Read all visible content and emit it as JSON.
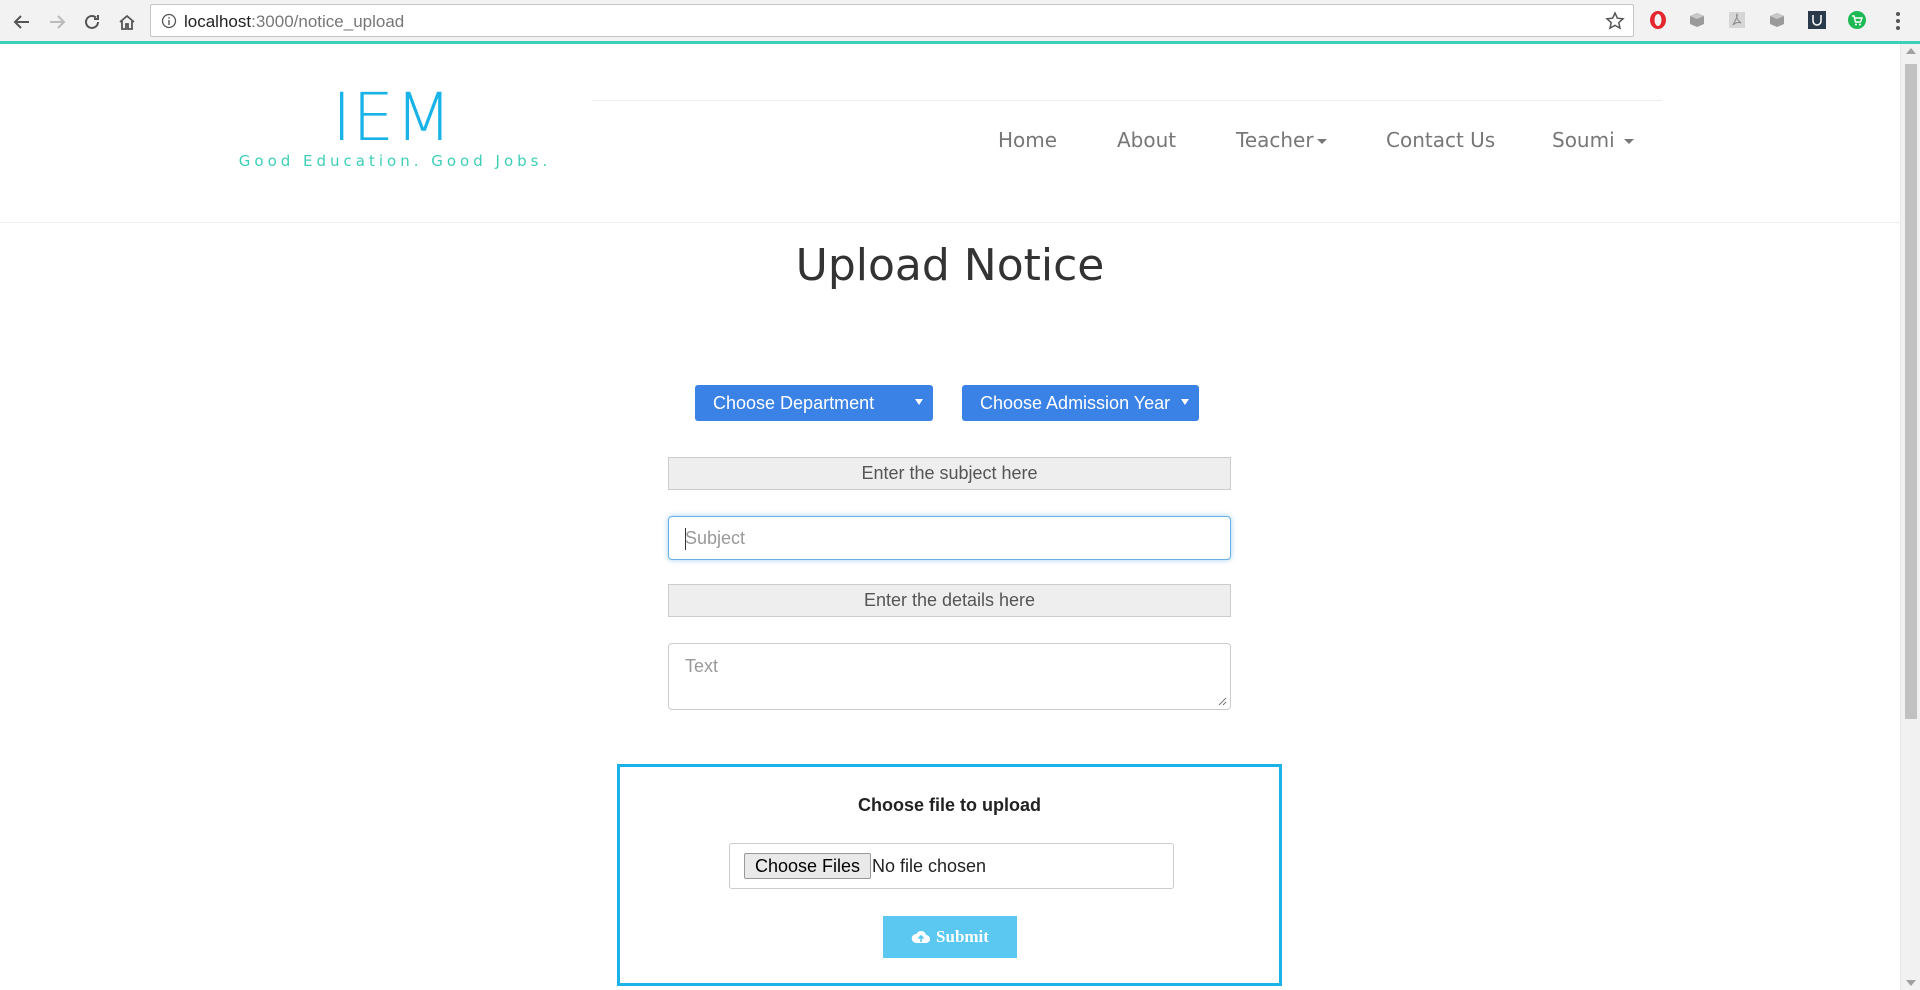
{
  "browser": {
    "url_host": "localhost",
    "url_path": ":3000/notice_upload"
  },
  "site": {
    "logo": "IEM",
    "tagline": "Good Education. Good Jobs.",
    "nav": {
      "home": "Home",
      "about": "About",
      "teacher": "Teacher",
      "contact": "Contact Us",
      "user": "Soumi"
    }
  },
  "page": {
    "title": "Upload Notice",
    "department_select": "Choose Department",
    "admission_year_select": "Choose Admission Year",
    "subject_label": "Enter the subject here",
    "subject_placeholder": "Subject",
    "details_label": "Enter the details here",
    "details_placeholder": "Text",
    "upload": {
      "title": "Choose file to upload",
      "choose_files": "Choose Files",
      "status": "No file chosen",
      "submit": "Submit"
    }
  },
  "colors": {
    "accent_blue": "#1ab3e8",
    "accent_teal": "#3ccfb8",
    "select_blue": "#3b82e6",
    "submit_light_blue": "#5bc8f2"
  }
}
